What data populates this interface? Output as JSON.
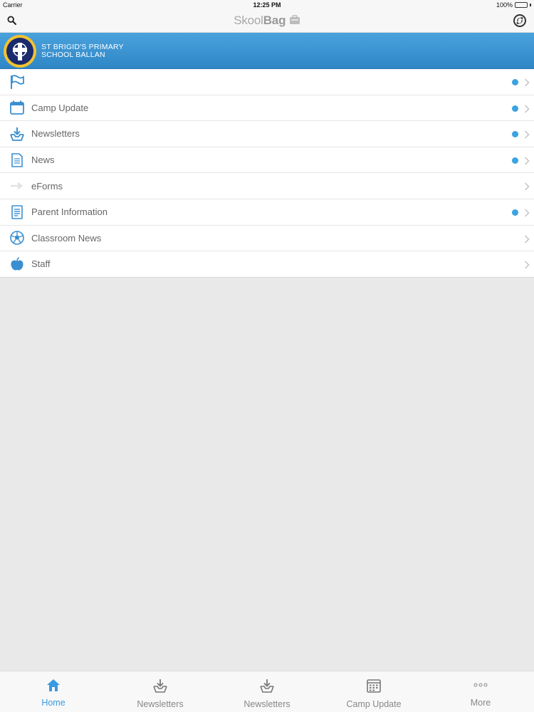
{
  "status_bar": {
    "carrier": "Carrier",
    "time": "12:25 PM",
    "battery": "100%"
  },
  "nav_bar": {
    "brand_prefix": "Skool",
    "brand_suffix": "Bag"
  },
  "school": {
    "name_line1": "ST BRIGID'S PRIMARY",
    "name_line2": "SCHOOL BALLAN"
  },
  "menu": {
    "items": [
      {
        "label": "",
        "icon": "flag-icon",
        "has_badge": true
      },
      {
        "label": "Camp Update",
        "icon": "calendar-icon",
        "has_badge": true
      },
      {
        "label": "Newsletters",
        "icon": "download-tray-icon",
        "has_badge": true
      },
      {
        "label": "News",
        "icon": "document-icon",
        "has_badge": true
      },
      {
        "label": "eForms",
        "icon": "arrow-icon",
        "has_badge": false
      },
      {
        "label": "Parent Information",
        "icon": "notepad-icon",
        "has_badge": true
      },
      {
        "label": "Classroom News",
        "icon": "soccer-ball-icon",
        "has_badge": false
      },
      {
        "label": "Staff",
        "icon": "apple-icon",
        "has_badge": false
      }
    ]
  },
  "tab_bar": {
    "tabs": [
      {
        "label": "Home",
        "icon": "home-icon",
        "active": true
      },
      {
        "label": "Newsletters",
        "icon": "download-tray-icon",
        "active": false
      },
      {
        "label": "Newsletters",
        "icon": "download-tray-icon",
        "active": false
      },
      {
        "label": "Camp Update",
        "icon": "calendar-icon",
        "active": false
      },
      {
        "label": "More",
        "icon": "more-dots-icon",
        "active": false
      }
    ]
  },
  "colors": {
    "accent": "#3a9be0",
    "banner": "#3a94d4",
    "badge": "#3aa3e0"
  }
}
